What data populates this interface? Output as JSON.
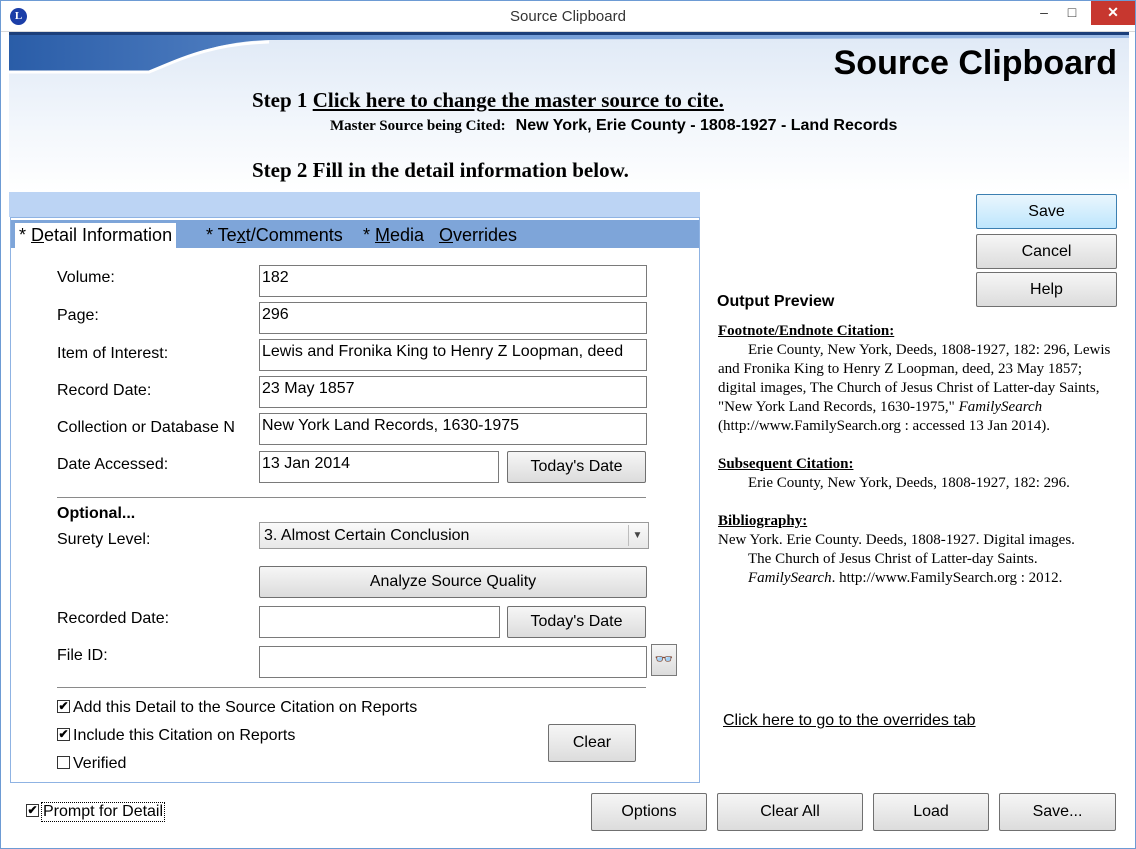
{
  "window": {
    "title": "Source Clipboard",
    "icon_letter": "L",
    "min_glyph": "–",
    "max_glyph": "□",
    "close_glyph": "✕"
  },
  "banner": {
    "title": "Source Clipboard"
  },
  "step1": {
    "prefix": "Step 1",
    "link": "Click here to change the master source to cite."
  },
  "master": {
    "label": "Master Source being Cited:",
    "value": "New York, Erie County - 1808-1927 - Land Records"
  },
  "step2": {
    "text": "Step 2 Fill in the detail information below."
  },
  "tabs": [
    {
      "pre": "* ",
      "u": "D",
      "post": "etail Information"
    },
    {
      "pre": "* Te",
      "u": "x",
      "post": "t/Comments"
    },
    {
      "pre": "* ",
      "u": "M",
      "post": "edia"
    },
    {
      "pre": "",
      "u": "O",
      "post": "verrides"
    }
  ],
  "fields": {
    "volume": {
      "label": "Volume:",
      "value": "182"
    },
    "page": {
      "label": "Page:",
      "value": "296"
    },
    "item": {
      "label": "Item of Interest:",
      "value": "Lewis and Fronika King to Henry Z Loopman, deed"
    },
    "record_date": {
      "label": "Record Date:",
      "value": "23 May 1857"
    },
    "collection": {
      "label": "Collection or Database N",
      "value": "New York Land Records, 1630-1975"
    },
    "date_accessed": {
      "label": "Date Accessed:",
      "value": "13 Jan 2014"
    },
    "optional": "Optional...",
    "surety": {
      "label": "Surety Level:",
      "value": "3.  Almost Certain Conclusion",
      "arrow": "▼"
    },
    "recorded_date": {
      "label": "Recorded Date:",
      "value": ""
    },
    "file_id": {
      "label": "File ID:",
      "value": ""
    }
  },
  "buttons": {
    "todays_date": "Today's Date",
    "analyze": "Analyze Source Quality",
    "clear": "Clear",
    "save": "Save",
    "cancel": "Cancel",
    "help": "Help",
    "options": "Options",
    "clear_all": "Clear All",
    "load": "Load",
    "save_as": "Save...",
    "binoculars": "👓"
  },
  "checks": {
    "add_detail": {
      "label": "Add this Detail to the Source Citation on Reports",
      "checked": true
    },
    "include": {
      "label": "Include this Citation on Reports",
      "checked": true
    },
    "verified": {
      "label": "Verified",
      "checked": false
    },
    "prompt": {
      "label": "Prompt for Detail",
      "checked": true
    }
  },
  "preview": {
    "title": "Output Preview",
    "footnote_head": "Footnote/Endnote Citation:",
    "footnote_text": "Erie County, New York, Deeds, 1808-1927, 182: 296, Lewis and Fronika King to Henry Z Loopman, deed, 23 May 1857; digital images, The Church of Jesus Christ of Latter-day Saints, \"New York Land Records, 1630-1975,\"",
    "footnote_italic": "FamilySearch",
    "footnote_tail": "(http://www.FamilySearch.org : accessed 13 Jan 2014).",
    "subsequent_head": "Subsequent Citation:",
    "subsequent_text": "Erie County, New York, Deeds, 1808-1927, 182: 296.",
    "bib_head": "Bibliography:",
    "bib_line1": "New York. Erie County. Deeds, 1808-1927. Digital images.",
    "bib_line2": "The Church of Jesus Christ of Latter-day Saints.",
    "bib_italic": "FamilySearch",
    "bib_tail": ". http://www.FamilySearch.org : 2012.",
    "overrides_link": "Click here to go to the overrides tab"
  }
}
